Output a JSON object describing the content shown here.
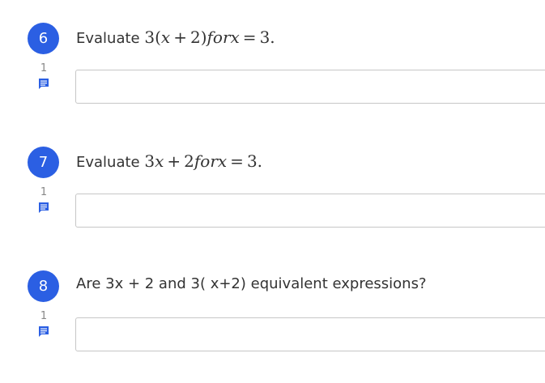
{
  "questions": [
    {
      "number": "6",
      "comment_count": "1",
      "prompt_prefix": "Evaluate ",
      "prompt_math": "3(x + 2)forx = 3.",
      "answer_value": ""
    },
    {
      "number": "7",
      "comment_count": "1",
      "prompt_prefix": "Evaluate ",
      "prompt_math": "3x + 2forx = 3.",
      "answer_value": ""
    },
    {
      "number": "8",
      "comment_count": "1",
      "prompt_text": "Are 3x + 2 and 3( x+2)  equivalent expressions?",
      "answer_value": ""
    }
  ],
  "colors": {
    "badge": "#2b5fe3",
    "comment_icon": "#2b5fe3",
    "input_border": "#c6c6c6"
  },
  "icons": {
    "comment": "comment-icon"
  }
}
